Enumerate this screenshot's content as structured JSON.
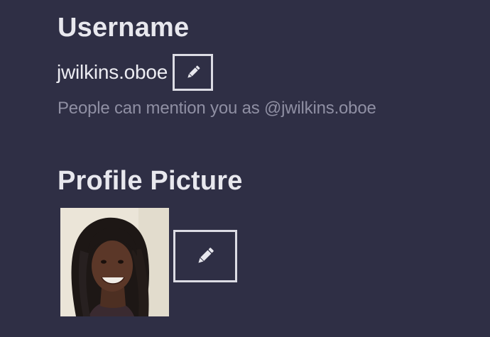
{
  "username": {
    "title": "Username",
    "value": "jwilkins.oboe",
    "mention_hint": "People can mention you as @jwilkins.oboe",
    "edit_icon": "pencil-icon"
  },
  "profile_picture": {
    "title": "Profile Picture",
    "avatar": "photo-of-smiling-person-with-braids",
    "edit_icon": "pencil-icon"
  },
  "colors": {
    "background": "#2f2f45",
    "heading": "#e8e8ee",
    "text": "#ececf2",
    "muted": "#8f8fa3",
    "button_border": "#dcdce4"
  }
}
